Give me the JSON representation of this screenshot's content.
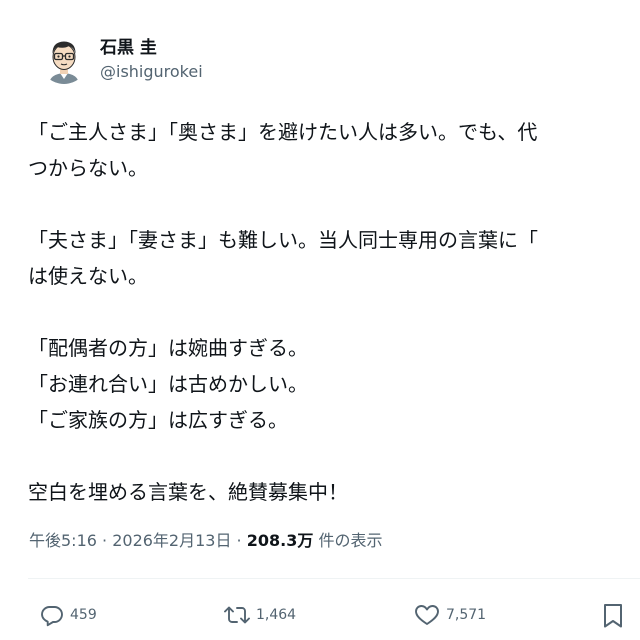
{
  "author": {
    "display_name": "石黒 圭",
    "handle": "@ishigurokei"
  },
  "tweet": {
    "paragraphs": [
      [
        "「ご主人さま」「奥さま」を避けたい人は多い。でも、代",
        "つからない。"
      ],
      [
        "「夫さま」「妻さま」も難しい。当人同士専用の言葉に「",
        "は使えない。"
      ],
      [
        "「配偶者の方」は婉曲すぎる。",
        "「お連れ合い」は古めかしい。",
        "「ご家族の方」は広すぎる。"
      ],
      [
        "空白を埋める言葉を、絶賛募集中！"
      ]
    ]
  },
  "meta": {
    "time": "午後5:16",
    "separator1": " · ",
    "date": "2026年2月13日",
    "separator2": " · ",
    "views_count": "208.3万",
    "views_label": " 件の表示"
  },
  "actions": {
    "reply_count": "459",
    "retweet_count": "1,464",
    "like_count": "7,571"
  },
  "icons": {
    "reply": "speech-bubble-icon",
    "retweet": "retweet-arrows-icon",
    "like": "heart-icon",
    "bookmark": "bookmark-icon"
  },
  "colors": {
    "text": "#0f1419",
    "secondary": "#536471",
    "divider": "#eff3f4"
  }
}
